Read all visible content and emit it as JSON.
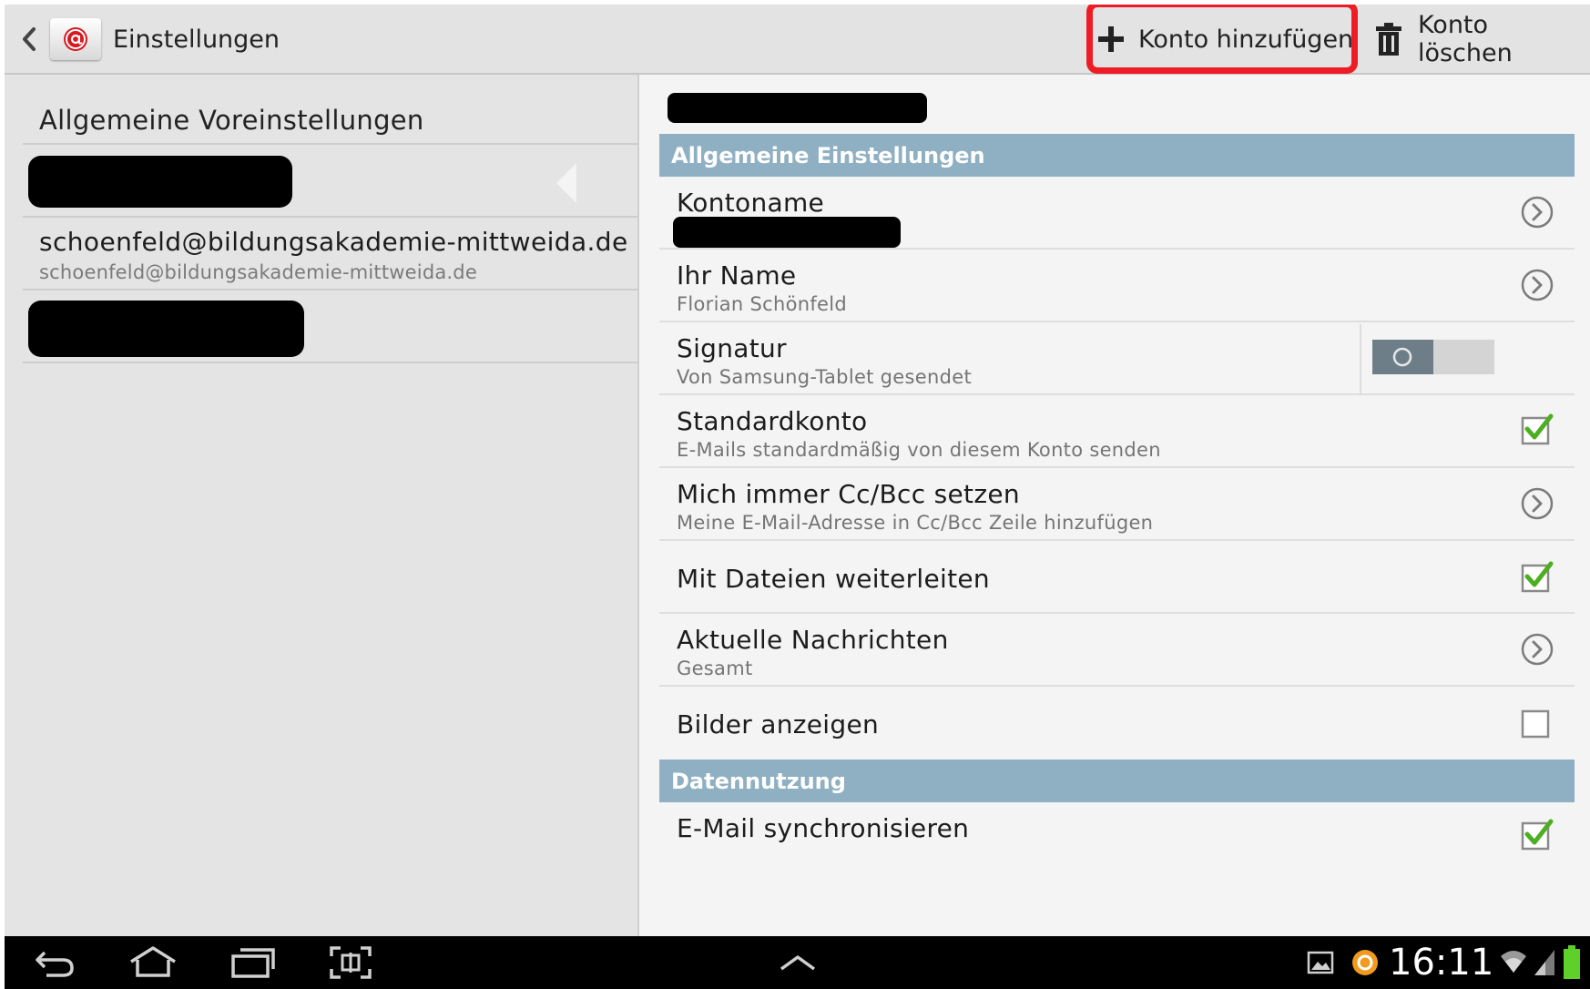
{
  "actionbar": {
    "title": "Einstellungen",
    "add_account_label": "Konto hinzufügen",
    "delete_account_label": "Konto löschen"
  },
  "sidebar": {
    "header": "Allgemeine Voreinstellungen",
    "accounts": [
      {
        "name": "",
        "address": "",
        "redacted": true
      },
      {
        "name": "schoenfeld@bildungsakademie-mittweida.de",
        "address": "schoenfeld@bildungsakademie-mittweida.de",
        "selected": true
      },
      {
        "name": "",
        "address": "",
        "redacted": true
      }
    ]
  },
  "detail": {
    "sections": [
      {
        "title": "Allgemeine Einstellungen",
        "items": [
          {
            "title": "Kontoname",
            "subtitle": "",
            "control": "chevron",
            "subtitle_redacted": true
          },
          {
            "title": "Ihr Name",
            "subtitle": "Florian Schönfeld",
            "control": "chevron"
          },
          {
            "title": "Signatur",
            "subtitle": "Von Samsung-Tablet gesendet",
            "control": "toggle",
            "checked": false
          },
          {
            "title": "Standardkonto",
            "subtitle": "E-Mails standardmäßig von diesem Konto senden",
            "control": "checkbox",
            "checked": true
          },
          {
            "title": "Mich immer Cc/Bcc setzen",
            "subtitle": "Meine E-Mail-Adresse in Cc/Bcc Zeile hinzufügen",
            "control": "chevron"
          },
          {
            "title": "Mit Dateien weiterleiten",
            "subtitle": "",
            "control": "checkbox",
            "checked": true
          },
          {
            "title": "Aktuelle Nachrichten",
            "subtitle": "Gesamt",
            "control": "chevron"
          },
          {
            "title": "Bilder anzeigen",
            "subtitle": "",
            "control": "checkbox",
            "checked": false
          }
        ]
      },
      {
        "title": "Datennutzung",
        "items": [
          {
            "title": "E-Mail synchronisieren",
            "subtitle": "",
            "control": "checkbox",
            "checked": true
          }
        ]
      }
    ]
  },
  "statusbar": {
    "time": "16:11"
  },
  "colors": {
    "section_header_bg": "#8fb0c2",
    "highlight_border": "#ee1c25",
    "checkmark": "#4caf1f",
    "battery": "#5fd02a"
  }
}
